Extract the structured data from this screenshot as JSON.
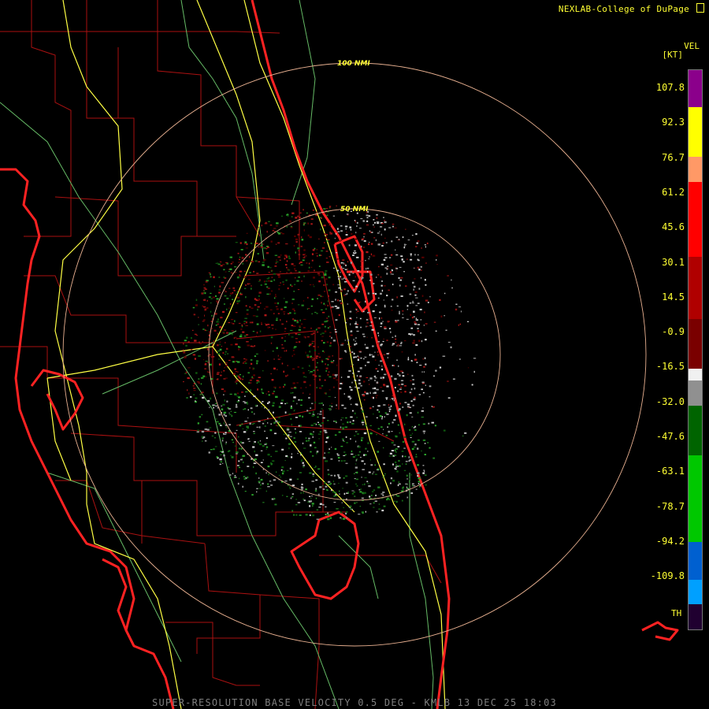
{
  "credit": "NEXLAB-College of DuPage",
  "product_caption": "SUPER-RESOLUTION BASE VELOCITY 0.5 DEG - KMLB 13 DEC 25 18:03",
  "legend": {
    "title": "VEL",
    "unit": "[KT]",
    "ticks": [
      "107.8",
      "92.3",
      "76.7",
      "61.2",
      "45.6",
      "30.1",
      "14.5",
      "-0.9",
      "-16.5",
      "-32.0",
      "-47.6",
      "-63.1",
      "-78.7",
      "-94.2",
      "-109.8"
    ],
    "range_folded_label": "TH",
    "segments": [
      {
        "color": "#8b008b",
        "weight": 3
      },
      {
        "color": "#ffff00",
        "weight": 4
      },
      {
        "color": "#ff9966",
        "weight": 2
      },
      {
        "color": "#ff0000",
        "weight": 6
      },
      {
        "color": "#b00000",
        "weight": 5
      },
      {
        "color": "#7a0000",
        "weight": 4
      },
      {
        "color": "#f0f0f0",
        "weight": 1
      },
      {
        "color": "#909090",
        "weight": 2
      },
      {
        "color": "#006400",
        "weight": 4
      },
      {
        "color": "#00c800",
        "weight": 7
      },
      {
        "color": "#0060d0",
        "weight": 3
      },
      {
        "color": "#00a0ff",
        "weight": 2
      },
      {
        "color": "#200030",
        "weight": 2
      }
    ]
  },
  "range_rings": [
    {
      "label": "100 NMI",
      "radius_nmi": 100
    },
    {
      "label": "50 NMI",
      "radius_nmi": 50
    }
  ],
  "colors": {
    "coast": "#ff2222",
    "county": "#aa1111",
    "state_road": "#ffff44",
    "river": "#66bb66",
    "ring": "#e8b090",
    "text": "#ffff33"
  }
}
